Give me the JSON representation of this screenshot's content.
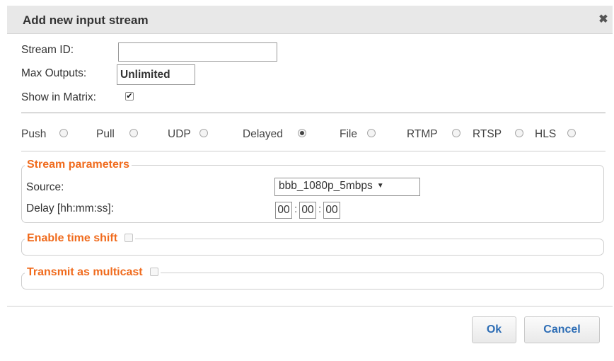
{
  "dialog": {
    "title": "Add new input stream",
    "close_glyph": "✖"
  },
  "form": {
    "stream_id_label": "Stream ID:",
    "stream_id_value": "",
    "max_outputs_label": "Max Outputs:",
    "max_outputs_value": "Unlimited",
    "show_in_matrix_label": "Show in Matrix:",
    "show_in_matrix_checked": true,
    "check_glyph": "✔"
  },
  "stream_types": {
    "options": [
      "Push",
      "Pull",
      "UDP",
      "Delayed",
      "File",
      "RTMP",
      "RTSP",
      "HLS"
    ],
    "selected": "Delayed"
  },
  "stream_parameters": {
    "legend": "Stream parameters",
    "source_label": "Source:",
    "source_value": "bbb_1080p_5mbps",
    "source_arrow": "▼",
    "delay_label": "Delay [hh:mm:ss]:",
    "delay_hh": "00",
    "delay_mm": "00",
    "delay_ss": "00",
    "separator": ":"
  },
  "time_shift": {
    "legend": "Enable time shift",
    "checked": false
  },
  "multicast": {
    "legend": "Transmit as multicast",
    "checked": false
  },
  "buttons": {
    "ok": "Ok",
    "cancel": "Cancel"
  },
  "colors": {
    "accent_orange": "#f06b1d",
    "button_text": "#2d6db5",
    "title_bg": "#e8e8e8"
  }
}
